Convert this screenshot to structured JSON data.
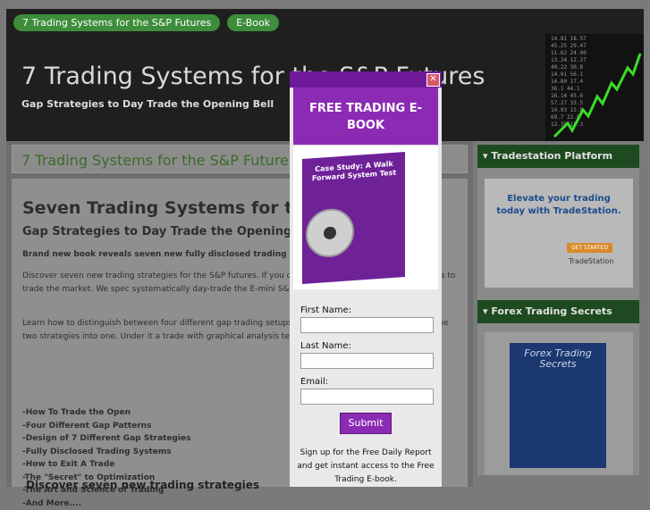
{
  "nav": {
    "items": [
      "7 Trading Systems for the S&P Futures",
      "E-Book"
    ]
  },
  "header": {
    "site_title": "7 Trading Systems for the S&P Futures",
    "tagline": "Gap Strategies to Day Trade the Opening Bell"
  },
  "main": {
    "page_title": "7 Trading Systems for the S&P Futures",
    "heading": "Seven Trading Systems for the S",
    "subheading": "Gap Strategies to Day Trade the Opening B",
    "para1": "Brand new book reveals seven new fully disclosed trading systems.",
    "para2": "Discover seven new trading strategies for the S&P futures. If you daily open can be one of the best ways to trade the market. We spec systematically day-trade the E-mini S&P 500 futures.",
    "para3": "Learn how to distinguish between four different gap trading setups a Continuation. Learn how to combine two strategies into one. Under it a trade with graphical analysis techniques.",
    "list": [
      "-How To Trade the Open",
      "-Four Different Gap Patterns",
      "-Design of 7 Different Gap Strategies",
      "-Fully Disclosed Trading Systems",
      "-How to Exit A Trade",
      "-The \"Secret\" to Optimization",
      "-The Art and Science of Trading",
      "-And More...."
    ],
    "bottom_heading": "Discover seven new trading strategies"
  },
  "sidebar": {
    "tradestation": {
      "title": "Tradestation Platform",
      "ad_text": "Elevate your trading today with TradeStation.",
      "ad_button": "GET STARTED",
      "ad_logo": "TradeStation"
    },
    "forex": {
      "title": "Forex Trading Secrets",
      "book_title": "Forex Trading Secrets"
    }
  },
  "popup": {
    "header": "FREE TRADING E-BOOK",
    "book_title": "Case Study: A Walk Forward System Test",
    "first_name_label": "First Name:",
    "last_name_label": "Last Name:",
    "email_label": "Email:",
    "submit_label": "Submit",
    "signup_text": "Sign up for the Free Daily Report and get instant access to the Free Trading E-book."
  },
  "colors": {
    "accent_green": "#3d8d3a",
    "popup_purple": "#8b2bb4"
  }
}
